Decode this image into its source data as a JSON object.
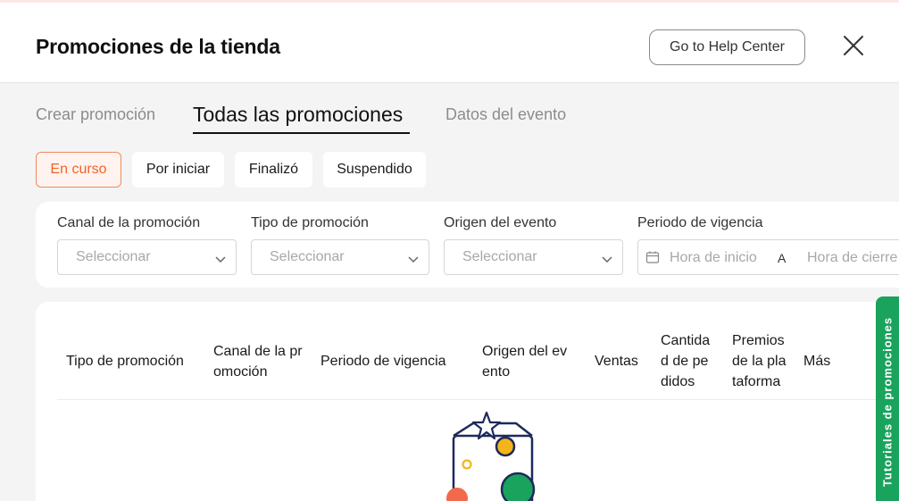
{
  "header": {
    "title": "Promociones de la tienda",
    "help_label": "Go to Help Center"
  },
  "tabs": [
    {
      "label": "Crear promoción",
      "active": false
    },
    {
      "label": "Todas las promociones",
      "active": true
    },
    {
      "label": "Datos del evento",
      "active": false
    }
  ],
  "status_filters": [
    {
      "label": "En curso",
      "active": true
    },
    {
      "label": "Por iniciar",
      "active": false
    },
    {
      "label": "Finalizó",
      "active": false
    },
    {
      "label": "Suspendido",
      "active": false
    }
  ],
  "filters": {
    "channel": {
      "label": "Canal de la promoción",
      "placeholder": "Seleccionar"
    },
    "type": {
      "label": "Tipo de promoción",
      "placeholder": "Seleccionar"
    },
    "origin": {
      "label": "Origen del evento",
      "placeholder": "Seleccionar"
    },
    "period": {
      "label": "Periodo de vigencia",
      "start_placeholder": "Hora de inicio",
      "separator": "A",
      "end_placeholder": "Hora de cierre"
    }
  },
  "table": {
    "columns": [
      [
        "Tipo de promoción"
      ],
      [
        "Canal de la pr",
        "omoción"
      ],
      [
        "Periodo de vigencia"
      ],
      [
        "Origen del ev",
        "ento"
      ],
      [
        "Ventas"
      ],
      [
        "Cantida",
        "d de pe",
        "didos"
      ],
      [
        "Premios",
        "de la pla",
        "taforma"
      ],
      [
        "Más"
      ]
    ]
  },
  "side_tab": {
    "label": "Tutoriales de promociones"
  },
  "colors": {
    "accent": "#f0642d",
    "side_tab": "#19a35c",
    "empty_illustration": [
      "#1d2a5c",
      "#f5b51a",
      "#f26a4b",
      "#19a35c"
    ]
  },
  "icons": [
    "close-icon",
    "chevron-down-icon",
    "calendar-icon",
    "empty-box-icon"
  ]
}
